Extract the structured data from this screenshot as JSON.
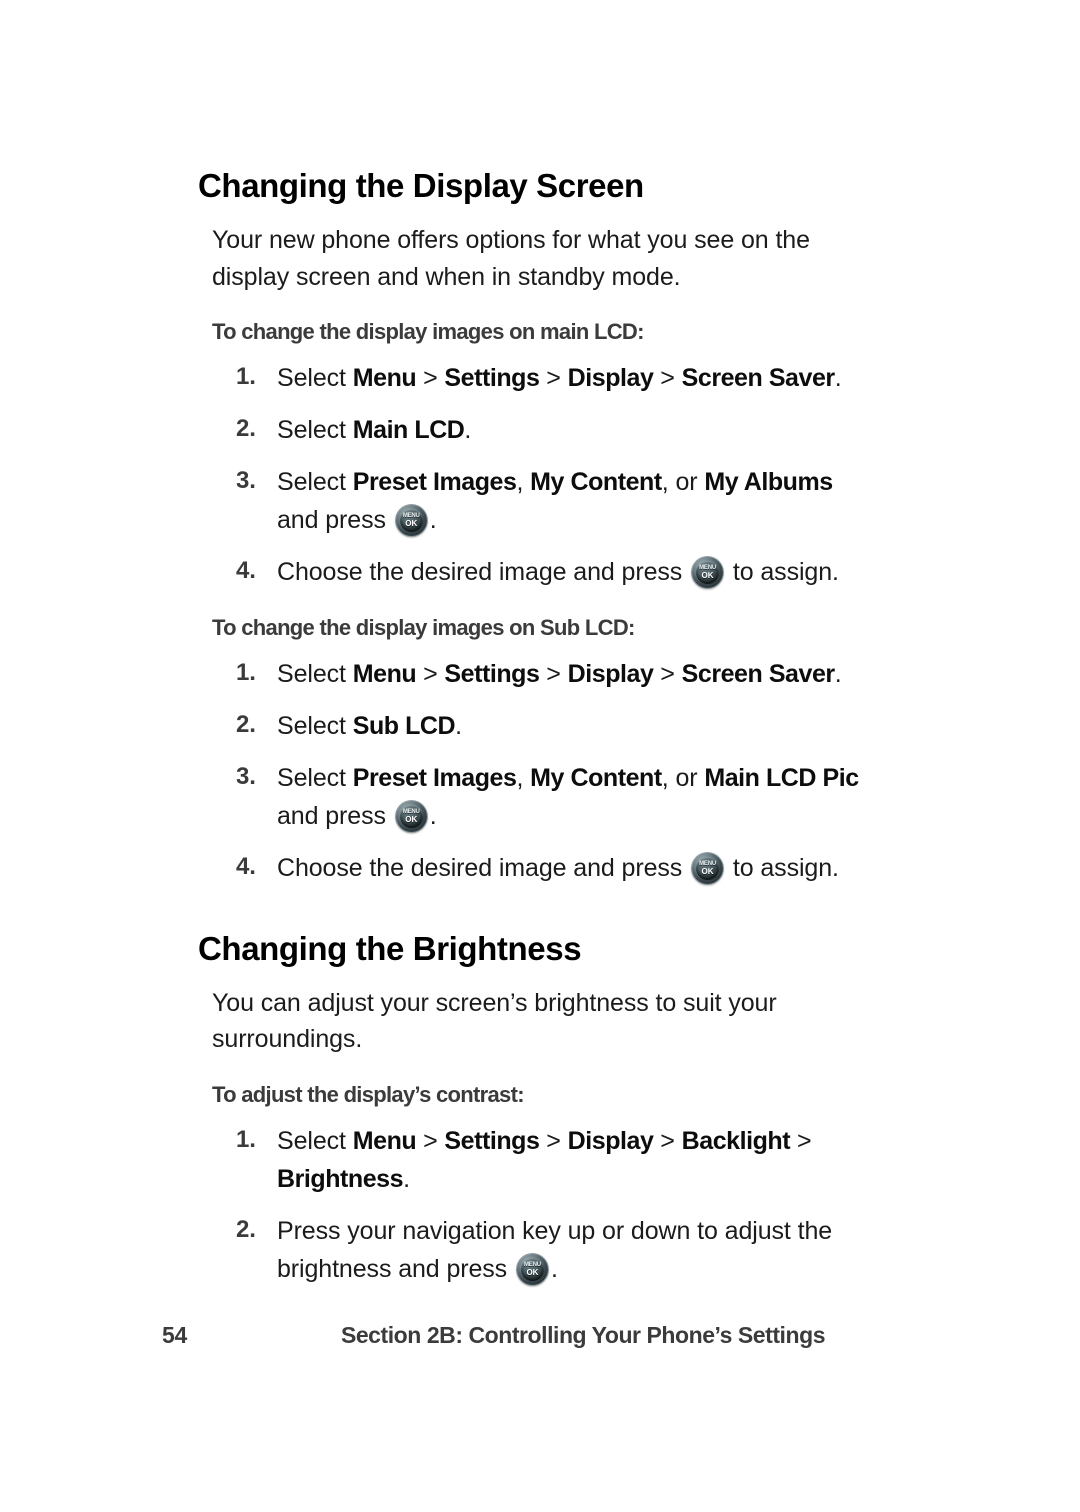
{
  "document": {
    "page_number": "54",
    "footer_section": "Section 2B: Controlling Your Phone’s Settings"
  },
  "icons": {
    "menu_ok_key": {
      "line1": "MENU",
      "line2": "OK",
      "name": "menu-ok-key-icon"
    }
  },
  "sections": [
    {
      "heading": "Changing the Display Screen",
      "intro": "Your new phone offers options for what you see on the display screen and when in standby mode.",
      "procedures": [
        {
          "title": "To change the display images on main LCD:",
          "steps": [
            {
              "number": "1.",
              "parts": [
                {
                  "t": "Select ",
                  "b": false
                },
                {
                  "t": "Menu",
                  "b": true
                },
                {
                  "t": " > ",
                  "b": false
                },
                {
                  "t": "Settings",
                  "b": true
                },
                {
                  "t": " > ",
                  "b": false
                },
                {
                  "t": "Display",
                  "b": true
                },
                {
                  "t": " > ",
                  "b": false
                },
                {
                  "t": "Screen Saver",
                  "b": true
                },
                {
                  "t": ".",
                  "b": false
                }
              ]
            },
            {
              "number": "2.",
              "parts": [
                {
                  "t": "Select ",
                  "b": false
                },
                {
                  "t": "Main LCD",
                  "b": true
                },
                {
                  "t": ".",
                  "b": false
                }
              ]
            },
            {
              "number": "3.",
              "parts": [
                {
                  "t": "Select ",
                  "b": false
                },
                {
                  "t": "Preset Images",
                  "b": true
                },
                {
                  "t": ", ",
                  "b": false
                },
                {
                  "t": "My Content",
                  "b": true
                },
                {
                  "t": ", or ",
                  "b": false
                },
                {
                  "t": "My Albums",
                  "b": true
                },
                {
                  "t": " and press ",
                  "b": false
                },
                {
                  "icon": "menu_ok_key"
                },
                {
                  "t": ".",
                  "b": false
                }
              ]
            },
            {
              "number": "4.",
              "parts": [
                {
                  "t": "Choose the desired image and press ",
                  "b": false
                },
                {
                  "icon": "menu_ok_key"
                },
                {
                  "t": " to assign.",
                  "b": false
                }
              ]
            }
          ]
        },
        {
          "title": "To change the display images on Sub LCD:",
          "steps": [
            {
              "number": "1.",
              "parts": [
                {
                  "t": "Select ",
                  "b": false
                },
                {
                  "t": "Menu",
                  "b": true
                },
                {
                  "t": " > ",
                  "b": false
                },
                {
                  "t": "Settings",
                  "b": true
                },
                {
                  "t": " > ",
                  "b": false
                },
                {
                  "t": "Display",
                  "b": true
                },
                {
                  "t": " > ",
                  "b": false
                },
                {
                  "t": "Screen Saver",
                  "b": true
                },
                {
                  "t": ".",
                  "b": false
                }
              ]
            },
            {
              "number": "2.",
              "parts": [
                {
                  "t": "Select ",
                  "b": false
                },
                {
                  "t": "Sub LCD",
                  "b": true
                },
                {
                  "t": ".",
                  "b": false
                }
              ]
            },
            {
              "number": "3.",
              "parts": [
                {
                  "t": "Select ",
                  "b": false
                },
                {
                  "t": "Preset Images",
                  "b": true
                },
                {
                  "t": ", ",
                  "b": false
                },
                {
                  "t": "My Content",
                  "b": true
                },
                {
                  "t": ", or ",
                  "b": false
                },
                {
                  "t": "Main LCD Pic",
                  "b": true
                },
                {
                  "t": " and press ",
                  "b": false
                },
                {
                  "icon": "menu_ok_key"
                },
                {
                  "t": ".",
                  "b": false
                }
              ]
            },
            {
              "number": "4.",
              "parts": [
                {
                  "t": "Choose the desired image and press ",
                  "b": false
                },
                {
                  "icon": "menu_ok_key"
                },
                {
                  "t": " to assign.",
                  "b": false
                }
              ]
            }
          ]
        }
      ]
    },
    {
      "heading": "Changing the Brightness",
      "intro": "You can adjust your screen’s brightness to suit your surroundings.",
      "procedures": [
        {
          "title": "To adjust the display’s contrast:",
          "steps": [
            {
              "number": "1.",
              "parts": [
                {
                  "t": "Select ",
                  "b": false
                },
                {
                  "t": "Menu",
                  "b": true
                },
                {
                  "t": " > ",
                  "b": false
                },
                {
                  "t": "Settings",
                  "b": true
                },
                {
                  "t": " > ",
                  "b": false
                },
                {
                  "t": "Display",
                  "b": true
                },
                {
                  "t": " > ",
                  "b": false
                },
                {
                  "t": "Backlight",
                  "b": true
                },
                {
                  "t": " > ",
                  "b": false
                },
                {
                  "t": "Brightness",
                  "b": true
                },
                {
                  "t": ".",
                  "b": false
                }
              ]
            },
            {
              "number": "2.",
              "parts": [
                {
                  "t": "Press your navigation key up or down to adjust the brightness and press ",
                  "b": false
                },
                {
                  "icon": "menu_ok_key"
                },
                {
                  "t": ".",
                  "b": false
                }
              ]
            }
          ]
        }
      ]
    }
  ]
}
